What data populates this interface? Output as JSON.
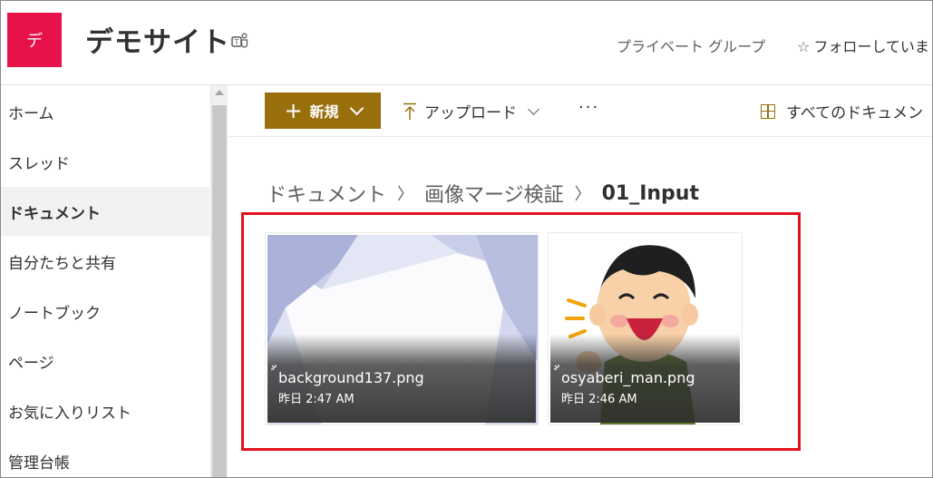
{
  "site": {
    "logo_letter": "デ",
    "title": "デモサイト",
    "privacy": "プライベート グループ",
    "follow": "フォローしていま"
  },
  "nav": {
    "items": [
      {
        "label": "ホーム",
        "active": false
      },
      {
        "label": "スレッド",
        "active": false
      },
      {
        "label": "ドキュメント",
        "active": true
      },
      {
        "label": "自分たちと共有",
        "active": false
      },
      {
        "label": "ノートブック",
        "active": false
      },
      {
        "label": "ページ",
        "active": false
      },
      {
        "label": "お気に入りリスト",
        "active": false
      },
      {
        "label": "管理台帳",
        "active": false
      }
    ]
  },
  "command_bar": {
    "new_label": "新規",
    "upload_label": "アップロード",
    "more_label": "···",
    "views_label": "すべてのドキュメン"
  },
  "breadcrumb": {
    "items": [
      "ドキュメント",
      "画像マージ検証"
    ],
    "current": "01_Input"
  },
  "files": [
    {
      "name": "background137.png",
      "modified": "昨日 2:47 AM"
    },
    {
      "name": "osyaberi_man.png",
      "modified": "昨日 2:46 AM"
    }
  ],
  "colors": {
    "brand": "#986f0b",
    "site_logo": "#e8114a",
    "highlight": "#e3111e"
  }
}
